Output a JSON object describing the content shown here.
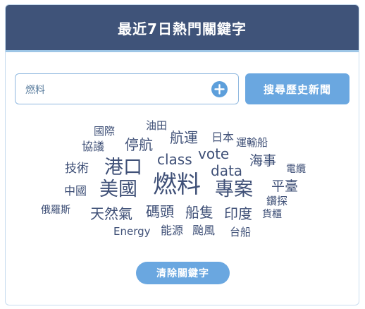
{
  "header": {
    "title": "最近7日熱門關鍵字"
  },
  "search": {
    "value": "燃料",
    "add_icon": "plus-circle-icon"
  },
  "buttons": {
    "history": "搜尋歷史新聞",
    "clear": "清除關鍵字"
  },
  "keywords": [
    "國際",
    "油田",
    "協議",
    "停航",
    "航運",
    "日本",
    "運輸船",
    "class",
    "vote",
    "海事",
    "技術",
    "港口",
    "data",
    "電纜",
    "燃料",
    "中國",
    "美國",
    "專案",
    "平臺",
    "鑽探",
    "俄羅斯",
    "天然氣",
    "碼頭",
    "船隻",
    "印度",
    "貨櫃",
    "Energy",
    "能源",
    "颱風",
    "台船"
  ],
  "colors": {
    "header_bg": "#3f5379",
    "accent": "#6aa7e0",
    "keyword_text": "#3f5077"
  }
}
